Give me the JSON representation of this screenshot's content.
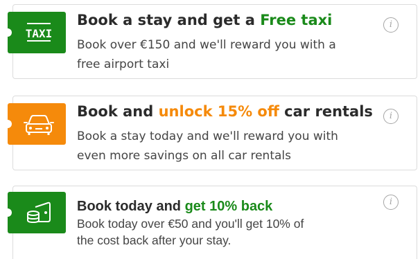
{
  "offers": [
    {
      "icon": "taxi-icon",
      "badge_text": "TAXI",
      "accent_color": "#1a8a1a",
      "title_prefix": "Book a stay and get a ",
      "title_highlight": "Free taxi",
      "title_suffix": "",
      "description_line1": "Book over €150 and we'll reward you with a",
      "description_line2": "free airport taxi",
      "info_icon": "info-icon"
    },
    {
      "icon": "car-icon",
      "accent_color": "#f58a0b",
      "title_prefix": "Book and ",
      "title_highlight": "unlock 15% off",
      "title_suffix": " car rentals",
      "description_line1": "Book a stay today and we'll reward you with",
      "description_line2": "even more savings on all car rentals",
      "info_icon": "info-icon"
    },
    {
      "icon": "wallet-coins-icon",
      "accent_color": "#1a8a1a",
      "title_prefix": "Book today and ",
      "title_highlight": "get 10% back",
      "title_suffix": "",
      "description_line1": "Book today over €50 and you'll get 10% of",
      "description_line2": "the cost back after your stay.",
      "info_icon": "info-icon"
    }
  ],
  "info_glyph": "i"
}
